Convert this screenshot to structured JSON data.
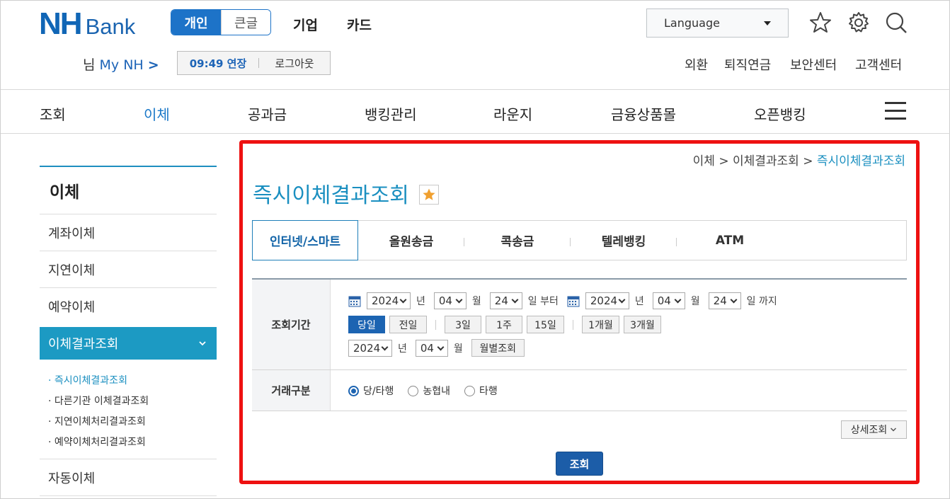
{
  "header": {
    "logo_nh": "NH",
    "logo_bank": "Bank",
    "mode_personal": "개인",
    "mode_large": "큰글",
    "link_business": "기업",
    "link_card": "카드",
    "language": "Language",
    "user_suffix": "님",
    "my_nh": "My NH",
    "my_nh_chevron": ">",
    "session_time": "09:49 연장",
    "logout": "로그아웃",
    "util_links": [
      "외환",
      "퇴직연금",
      "보안센터",
      "고객센터"
    ]
  },
  "gnb": [
    "조회",
    "이체",
    "공과금",
    "뱅킹관리",
    "라운지",
    "금융상품몰",
    "오픈뱅킹"
  ],
  "sidebar": {
    "title": "이체",
    "items": [
      "계좌이체",
      "지연이체",
      "예약이체",
      "이체결과조회",
      "자동이체"
    ],
    "sub_items": [
      "즉시이체결과조회",
      "다른기관 이체결과조회",
      "지연이체처리결과조회",
      "예약이체처리결과조회"
    ]
  },
  "breadcrumb": {
    "level1": "이체",
    "level2": "이체결과조회",
    "current": "즉시이체결과조회",
    "sep": ">"
  },
  "page": {
    "title": "즉시이체결과조회"
  },
  "tabs": [
    "인터넷/스마트",
    "올원송금",
    "콕송금",
    "텔레뱅킹",
    "ATM"
  ],
  "form": {
    "period_label": "조회기간",
    "from_year": "2024",
    "from_month": "04",
    "from_day": "24",
    "to_year": "2024",
    "to_month": "04",
    "to_day": "24",
    "unit_year": "년",
    "unit_month": "월",
    "unit_day_from": "일 부터",
    "unit_day_to": "일 까지",
    "quick_buttons": [
      "당일",
      "전일",
      "3일",
      "1주",
      "15일",
      "1개월",
      "3개월"
    ],
    "monthly_year": "2024",
    "monthly_month": "04",
    "monthly_button": "월별조회",
    "type_label": "거래구분",
    "type_options": [
      "당/타행",
      "농협내",
      "타행"
    ],
    "detail_button": "상세조회",
    "search_button": "조회"
  },
  "colors": {
    "brand_blue": "#1166b6",
    "accent_teal": "#1a8fc0",
    "highlight_red": "#ee1111"
  }
}
